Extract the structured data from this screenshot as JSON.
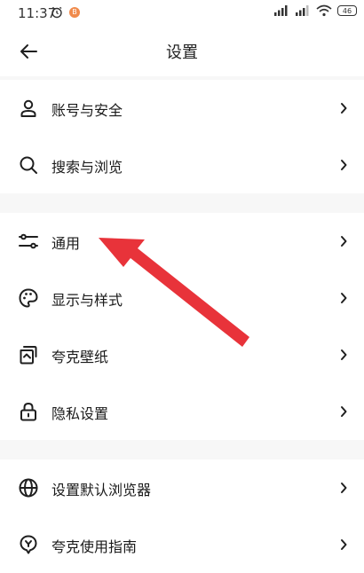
{
  "status_bar": {
    "time": "11:37",
    "app_badge": "B",
    "battery": "46"
  },
  "header": {
    "title": "设置"
  },
  "groups": [
    {
      "items": [
        {
          "label": "账号与安全",
          "icon": "person-icon"
        },
        {
          "label": "搜索与浏览",
          "icon": "search-icon"
        }
      ]
    },
    {
      "items": [
        {
          "label": "通用",
          "icon": "sliders-icon"
        },
        {
          "label": "显示与样式",
          "icon": "palette-icon"
        },
        {
          "label": "夸克壁纸",
          "icon": "wallpaper-icon"
        },
        {
          "label": "隐私设置",
          "icon": "lock-icon"
        }
      ]
    },
    {
      "items": [
        {
          "label": "设置默认浏览器",
          "icon": "globe-icon"
        },
        {
          "label": "夸克使用指南",
          "icon": "guide-icon"
        }
      ]
    }
  ],
  "colors": {
    "arrow": "#e8333a",
    "background": "#f7f7f7"
  }
}
